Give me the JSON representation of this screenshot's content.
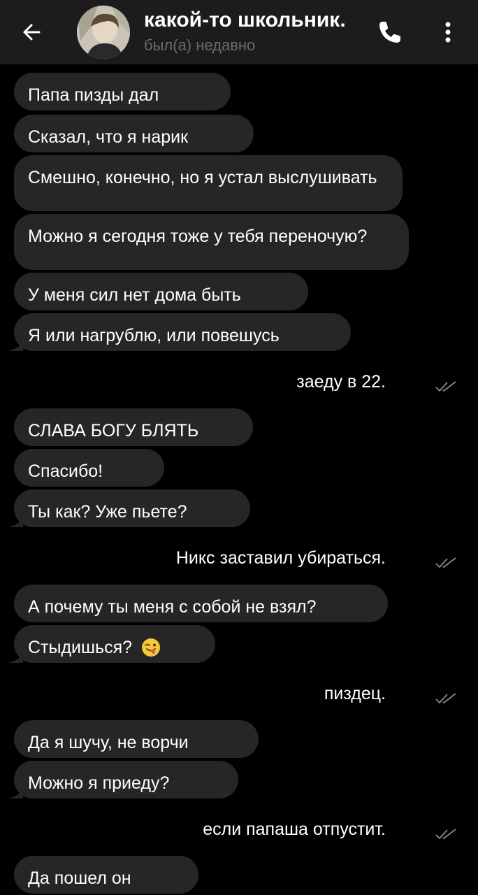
{
  "header": {
    "title": "какой-то школьник.",
    "status": "был(а) недавно"
  },
  "icons": {
    "back": "arrow-left-icon",
    "call": "phone-icon",
    "menu": "more-vertical-icon",
    "read": "double-check-icon",
    "emoji": "winking-face-with-tongue-emoji"
  },
  "colors": {
    "background": "#000000",
    "header": "#1c1c1e",
    "bubble_in": "#262628",
    "text": "#ffffff",
    "status": "#6b6b70"
  },
  "messages": [
    {
      "dir": "in",
      "text": "Папа пизды дал"
    },
    {
      "dir": "in",
      "text": "Сказал, что я нарик"
    },
    {
      "dir": "in",
      "text": "Смешно, конечно, но я устал выслушивать"
    },
    {
      "dir": "in",
      "text": "Можно я сегодня тоже у тебя переночую?"
    },
    {
      "dir": "in",
      "text": "У меня сил нет дома быть"
    },
    {
      "dir": "in",
      "text": "Я или нагрублю, или повешусь"
    },
    {
      "dir": "out",
      "text": "заеду в 22."
    },
    {
      "dir": "in",
      "text": "СЛАВА БОГУ БЛЯТЬ"
    },
    {
      "dir": "in",
      "text": "Спасибо!"
    },
    {
      "dir": "in",
      "text": "Ты как? Уже пьете?"
    },
    {
      "dir": "out",
      "text": "Никс заставил убираться."
    },
    {
      "dir": "in",
      "text": "А почему ты меня с собой не взял?"
    },
    {
      "dir": "in",
      "text": "Стыдишься?"
    },
    {
      "dir": "out",
      "text": "пиздец."
    },
    {
      "dir": "in",
      "text": "Да я шучу, не ворчи"
    },
    {
      "dir": "in",
      "text": "Можно я приеду?"
    },
    {
      "dir": "out",
      "text": "если папаша отпустит."
    },
    {
      "dir": "in",
      "text": "Да пошел он"
    }
  ]
}
